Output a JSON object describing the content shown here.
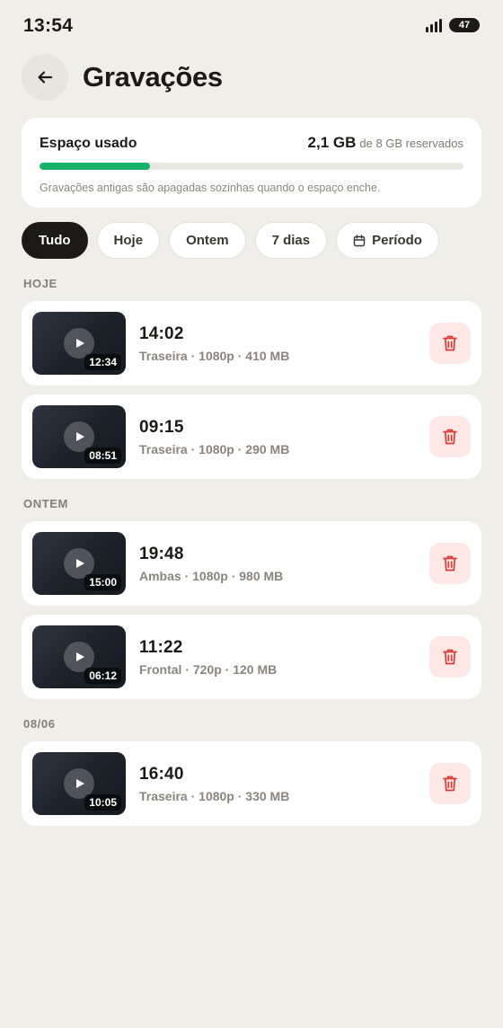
{
  "status_bar": {
    "time": "13:54",
    "battery": "47"
  },
  "header": {
    "title": "Gravações",
    "back_icon": "arrow-left-icon"
  },
  "storage": {
    "label": "Espaço usado",
    "used": "2,1 GB",
    "total": "de 8 GB reservados",
    "progress": 0.26,
    "note": "Gravações antigas são apagadas sozinhas quando o espaço enche.",
    "accent_color": "#17b26a"
  },
  "filters": [
    {
      "label": "Tudo",
      "active": true
    },
    {
      "label": "Hoje",
      "active": false
    },
    {
      "label": "Ontem",
      "active": false
    },
    {
      "label": "7 dias",
      "active": false
    },
    {
      "label": "Período",
      "active": false,
      "icon": "calendar-icon"
    }
  ],
  "sections": [
    {
      "label": "HOJE"
    },
    {
      "label": "ONTEM"
    },
    {
      "label": "08/06"
    }
  ],
  "recordings": [
    {
      "time": "14:02",
      "meta": "Traseira · 1080p · 410 MB",
      "duration": "12:34"
    },
    {
      "time": "09:15",
      "meta": "Traseira · 1080p · 290 MB",
      "duration": "08:51"
    },
    {
      "time": "19:48",
      "meta": "Ambas · 1080p · 980 MB",
      "duration": "15:00"
    },
    {
      "time": "11:22",
      "meta": "Frontal · 720p · 120 MB",
      "duration": "06:12"
    },
    {
      "time": "16:40",
      "meta": "Traseira · 1080p · 330 MB",
      "duration": "10:05"
    }
  ],
  "colors": {
    "background": "#efeee9",
    "delete_bg": "#fde8e6",
    "delete_icon": "#dc3b35"
  }
}
